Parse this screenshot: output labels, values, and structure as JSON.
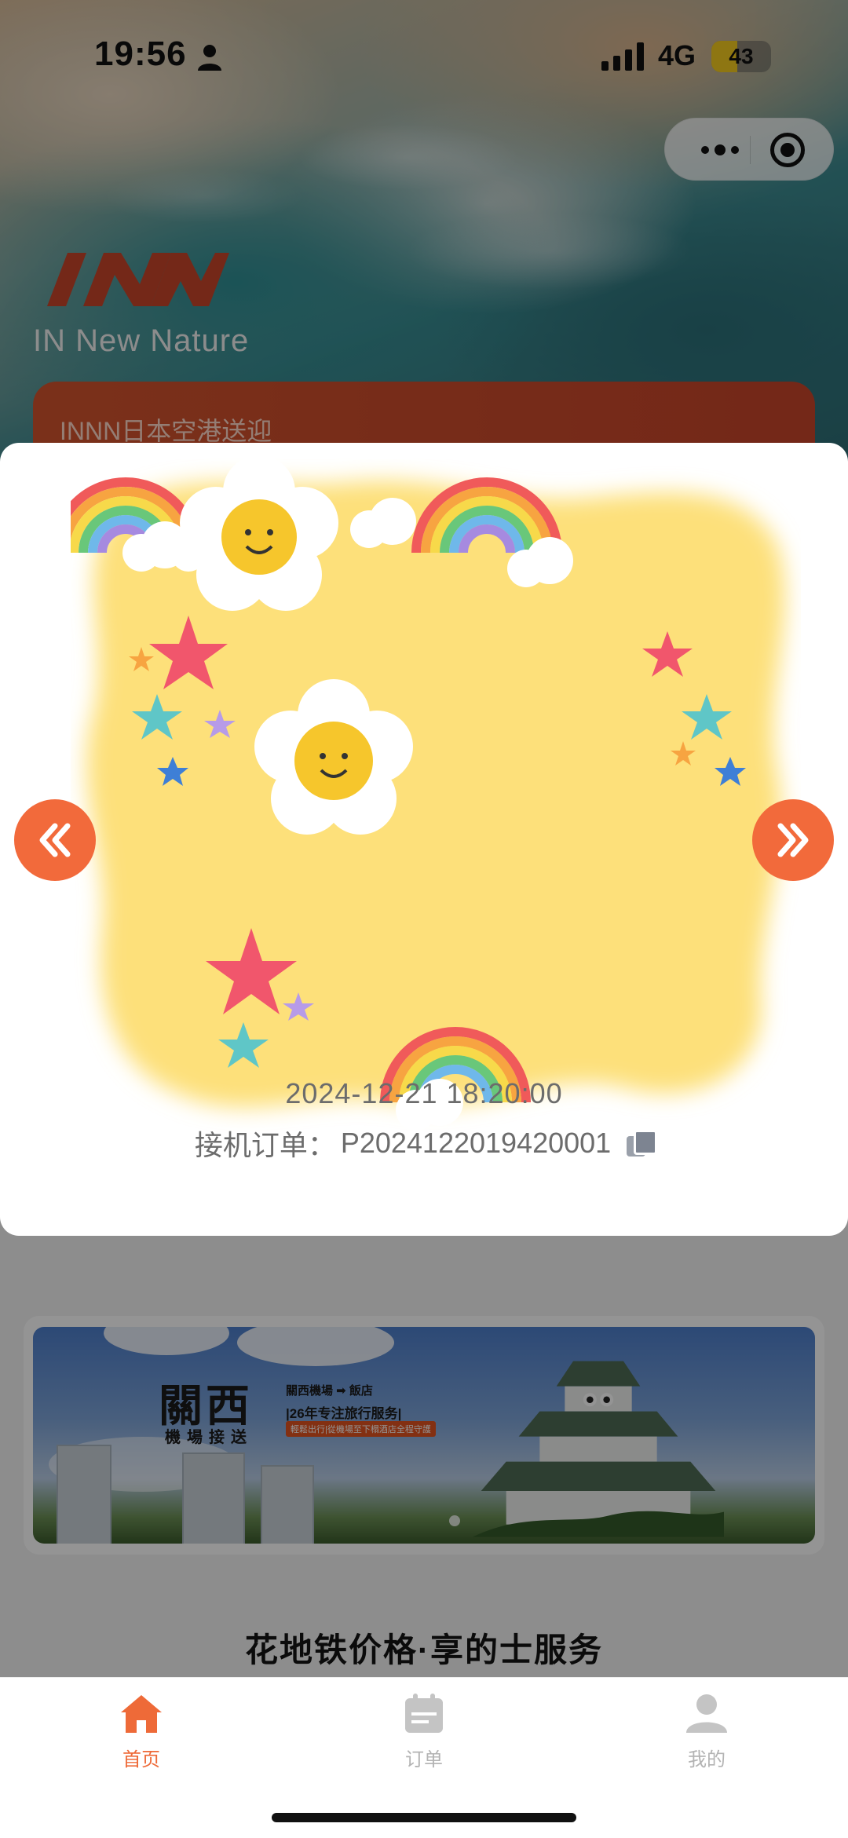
{
  "status_bar": {
    "time": "19:56",
    "network": "4G",
    "battery_level": 43,
    "battery_text": "43"
  },
  "capsule": {
    "more_icon": "more-dots-icon",
    "close_icon": "target-close-icon"
  },
  "brand": {
    "logo_icon": "innn-logo",
    "tagline": "IN New Nature",
    "service_title": "INNN日本空港送迎",
    "accent_color": "#d3542d"
  },
  "modal": {
    "date": "2024-12-21 18:20:00",
    "order_label": "接机订单：",
    "order_number": "P2024122019420001",
    "prev_icon": "double-chevron-left-icon",
    "next_icon": "double-chevron-right-icon",
    "arrow_color": "#f26a3b"
  },
  "promo": {
    "title_big": "關西",
    "title_small": "機場接送",
    "route": "關西機場 ➡ 飯店",
    "years": "|26年专注旅行服务|",
    "sub": "輕鬆出行|從機場至下榻酒店全程守護"
  },
  "slogan": "花地铁价格·享的士服务",
  "tabbar": {
    "items": [
      {
        "label": "首页",
        "icon": "home-icon",
        "active": true
      },
      {
        "label": "订单",
        "icon": "calendar-icon",
        "active": false
      },
      {
        "label": "我的",
        "icon": "user-icon",
        "active": false
      }
    ],
    "active_color": "#ee6a38",
    "inactive_color": "#b3b3b3"
  }
}
